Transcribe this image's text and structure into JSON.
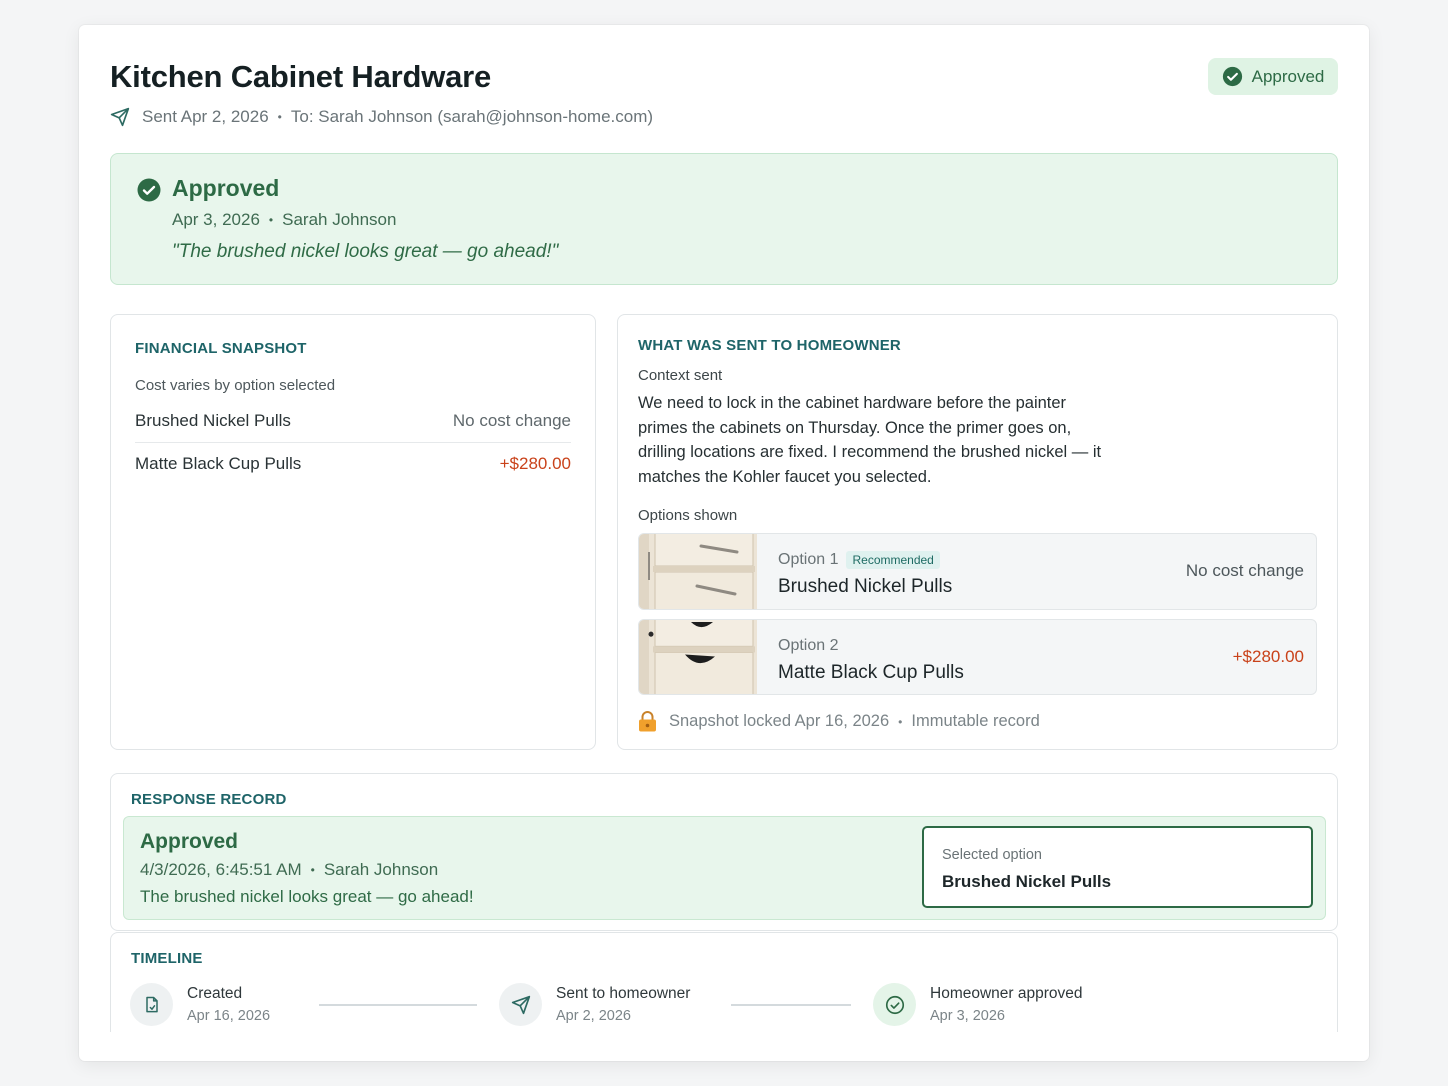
{
  "header": {
    "title": "Kitchen Cabinet Hardware",
    "sent": "Sent Apr 2, 2026",
    "to": "To: Sarah Johnson (sarah@johnson-home.com)",
    "status": "Approved"
  },
  "banner": {
    "title": "Approved",
    "date": "Apr 3, 2026",
    "by": "Sarah Johnson",
    "quote": "\"The brushed nickel looks great — go ahead!\""
  },
  "financial": {
    "label": "FINANCIAL SNAPSHOT",
    "subtitle": "Cost varies by option selected",
    "rows": [
      {
        "name": "Brushed Nickel Pulls",
        "value": "No cost change"
      },
      {
        "name": "Matte Black Cup Pulls",
        "value": "+$280.00"
      }
    ]
  },
  "sent": {
    "label": "WHAT WAS SENT TO HOMEOWNER",
    "context_label": "Context sent",
    "context_text": "We need to lock in the cabinet hardware before the painter primes the cabinets on Thursday. Once the primer goes on, drilling locations are fixed. I recommend the brushed nickel — it matches the Kohler faucet you selected.",
    "options_label": "Options shown",
    "options": [
      {
        "num": "Option 1",
        "badge": "Recommended",
        "name": "Brushed Nickel Pulls",
        "cost": "No cost change"
      },
      {
        "num": "Option 2",
        "name": "Matte Black Cup Pulls",
        "cost": "+$280.00"
      }
    ],
    "locked": "Snapshot locked Apr 16, 2026",
    "immutable": "Immutable record"
  },
  "response": {
    "label": "RESPONSE RECORD",
    "title": "Approved",
    "timestamp": "4/3/2026, 6:45:51 AM",
    "by": "Sarah Johnson",
    "text": "The brushed nickel looks great — go ahead!",
    "selected_label": "Selected option",
    "selected_value": "Brushed Nickel Pulls"
  },
  "timeline": {
    "label": "TIMELINE",
    "steps": [
      {
        "title": "Created",
        "date": "Apr 16, 2026",
        "icon": "document-icon"
      },
      {
        "title": "Sent to homeowner",
        "date": "Apr 2, 2026",
        "icon": "send-icon"
      },
      {
        "title": "Homeowner approved",
        "date": "Apr 3, 2026",
        "icon": "check-circle-icon"
      }
    ]
  },
  "colors": {
    "approved_green": "#2d6a45",
    "approved_bg": "#e8f6ec",
    "accent_teal": "#1e6468",
    "cost_red": "#c9421a",
    "lock_orange": "#f0a02c"
  }
}
